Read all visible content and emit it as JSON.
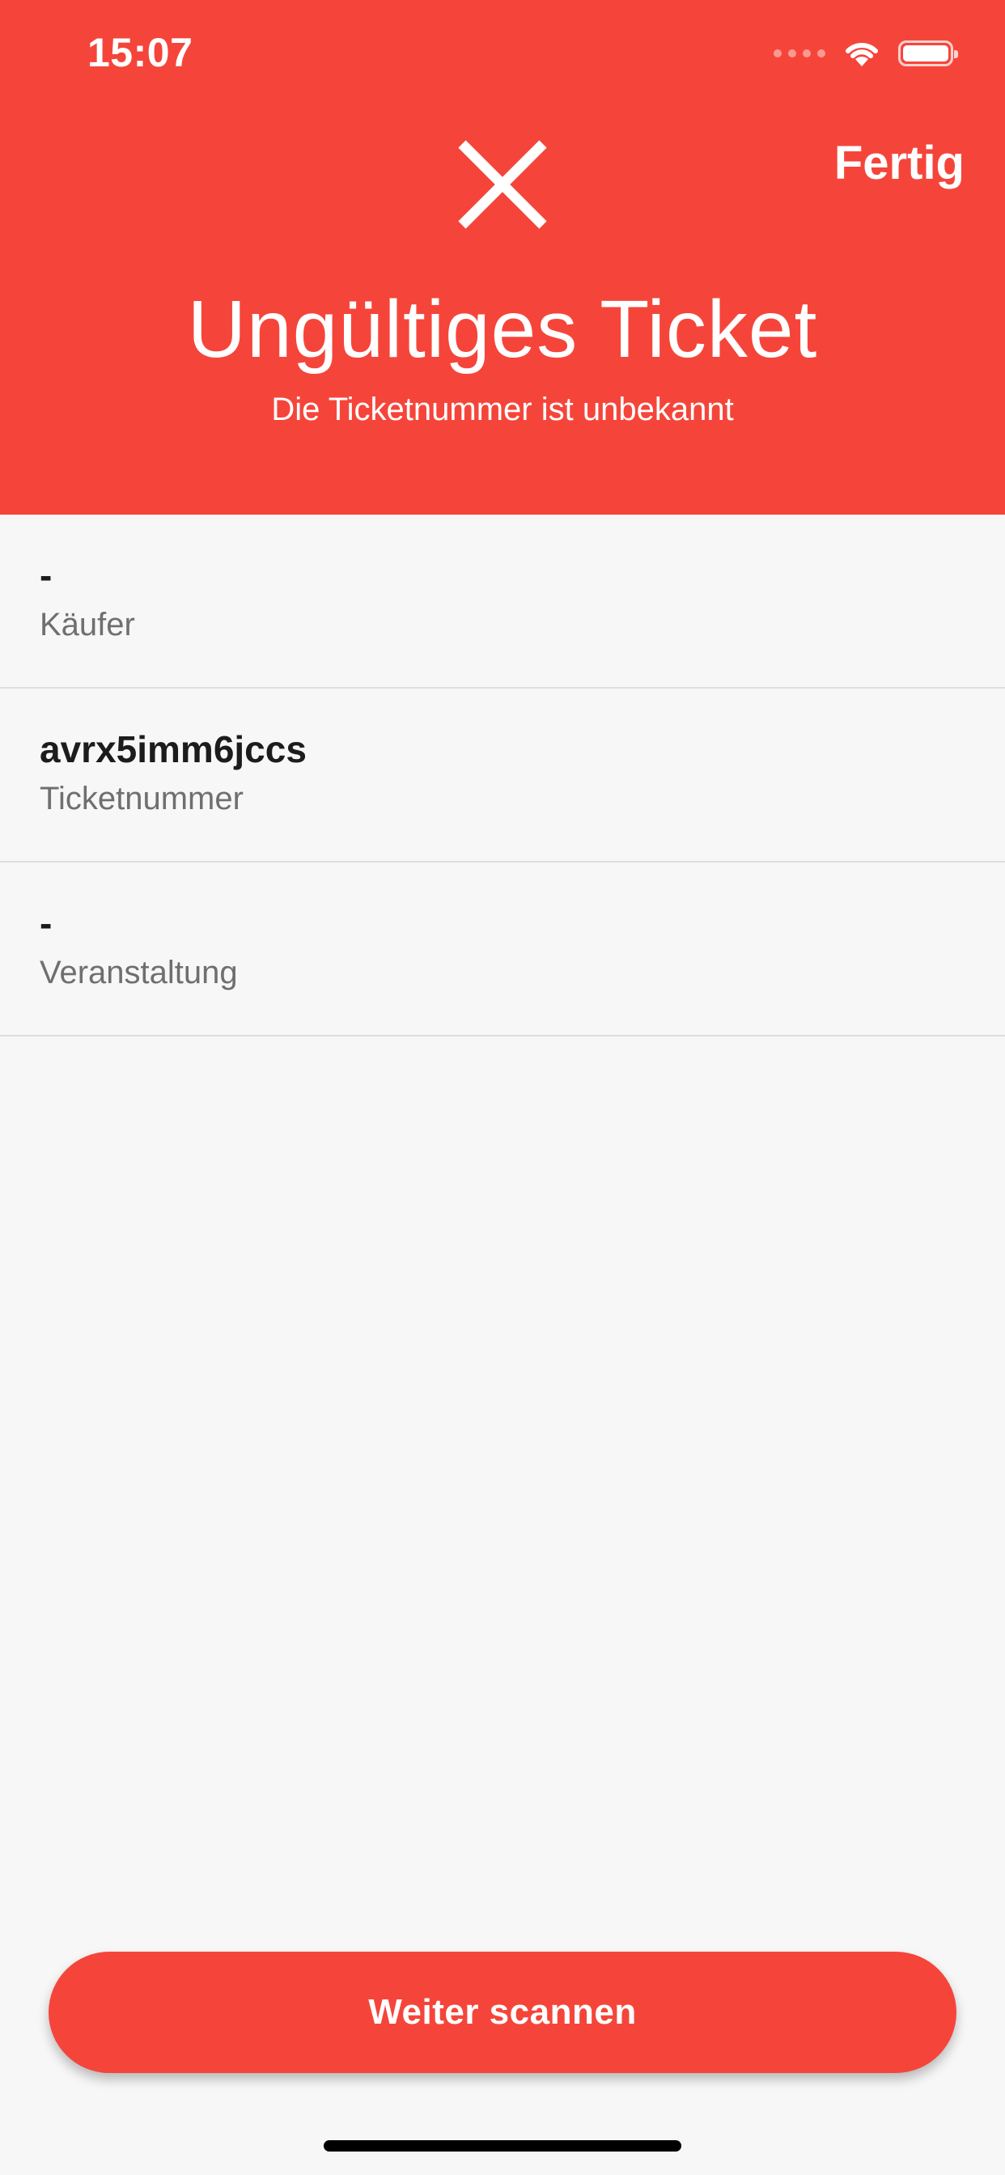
{
  "status_bar": {
    "time": "15:07"
  },
  "header": {
    "done_label": "Fertig",
    "status_icon": "close-x-icon",
    "title": "Ungültiges Ticket",
    "subtitle": "Die Ticketnummer ist unbekannt"
  },
  "details": [
    {
      "value": "-",
      "label": "Käufer"
    },
    {
      "value": "avrx5imm6jccs",
      "label": "Ticketnummer"
    },
    {
      "value": "-",
      "label": "Veranstaltung"
    }
  ],
  "footer": {
    "continue_label": "Weiter scannen"
  },
  "colors": {
    "accent": "#f5453a",
    "background": "#f7f7f7",
    "divider": "#dedede"
  }
}
